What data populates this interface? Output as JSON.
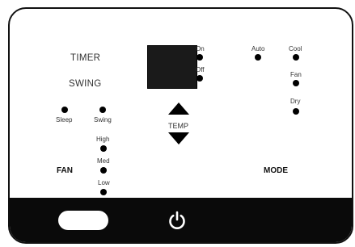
{
  "labels": {
    "timer": "TIMER",
    "swing_heading": "SWING",
    "on": "On",
    "off": "Off",
    "auto": "Auto",
    "cool": "Cool",
    "fan_mode": "Fan",
    "dry": "Dry",
    "sleep": "Sleep",
    "swing": "Swing",
    "temp": "TEMP",
    "high": "High",
    "med": "Med",
    "low": "Low",
    "fan": "FAN",
    "mode": "MODE"
  },
  "colors": {
    "panel_border": "#111111",
    "bottom_bar": "#0a0a0a",
    "display": "#1a1a1a",
    "indicator": "#000000"
  },
  "icons": {
    "power": "power-icon",
    "temp_up": "triangle-up-icon",
    "temp_down": "triangle-down-icon"
  }
}
